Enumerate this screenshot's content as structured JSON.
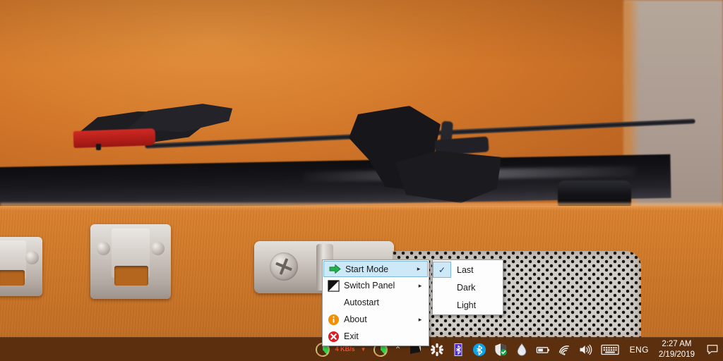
{
  "desktop": {
    "wallpaper_description": "turntable-in-orange-suitcase-photo",
    "colors": {
      "suitcase_orange": "#cf7828",
      "wall_beige": "#ab9b90",
      "grille_gray": "#cfcbc7",
      "taskbar_brown": "#562d0e",
      "menu_highlight": "#cde8f7",
      "menu_highlight_border": "#7cb8da",
      "arrow_green": "#22b14c",
      "info_orange": "#f29100",
      "exit_red": "#e01b24",
      "netspeed_red": "#ff4d2e"
    }
  },
  "context_menu": {
    "items": [
      {
        "label": "Start Mode",
        "icon": "green-arrow-icon",
        "has_submenu": true,
        "selected": true,
        "submenu_arrow": "▸"
      },
      {
        "label": "Switch Panel",
        "icon": "black-white-triangle-icon",
        "has_submenu": true,
        "selected": false,
        "submenu_arrow": "▸"
      },
      {
        "label": "Autostart",
        "icon": "",
        "has_submenu": false,
        "selected": false,
        "submenu_arrow": ""
      },
      {
        "label": "About",
        "icon": "info-circle-icon",
        "has_submenu": true,
        "selected": false,
        "submenu_arrow": "▸"
      },
      {
        "label": "Exit",
        "icon": "red-x-circle-icon",
        "has_submenu": false,
        "selected": false,
        "submenu_arrow": ""
      }
    ]
  },
  "start_mode_submenu": {
    "items": [
      {
        "label": "Last",
        "checked": true,
        "check_glyph": "✓"
      },
      {
        "label": "Dark",
        "checked": false,
        "check_glyph": ""
      },
      {
        "label": "Light",
        "checked": false,
        "check_glyph": ""
      }
    ]
  },
  "taskbar": {
    "network_speed": "4 KB/s",
    "network_speed_arrow": "▼",
    "show_hidden_icons": "⌃",
    "tray_icons": [
      "cpu-gauge-icon",
      "memory-gauge-icon",
      "show-hidden-icons-chevron",
      "black-flag-icon",
      "app-pinwheel-icon",
      "bluetooth-device-icon",
      "bluetooth-icon",
      "windows-defender-shield-icon",
      "water-drop-icon",
      "battery-icon",
      "wifi-icon",
      "volume-icon",
      "touch-keyboard-icon"
    ],
    "language": "ENG",
    "clock": {
      "time": "2:27 AM",
      "date": "2/19/2019"
    },
    "action_center_icon": "notification-speech-bubble-icon"
  }
}
